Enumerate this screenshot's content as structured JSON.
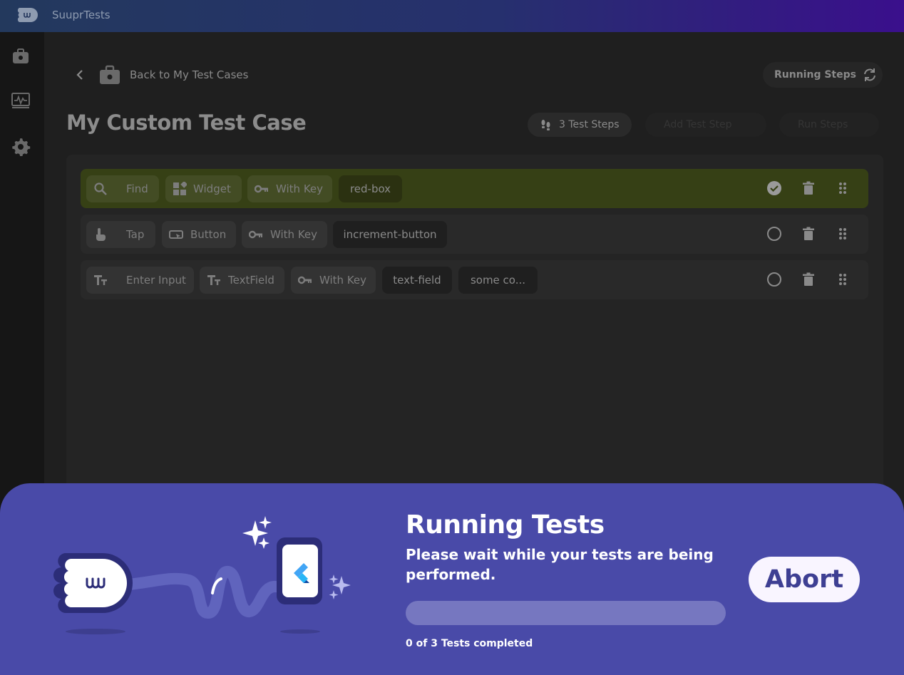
{
  "app": {
    "title": "SuuprTests"
  },
  "sidebar": {
    "items": [
      {
        "icon": "briefcase-icon"
      },
      {
        "icon": "monitor-pulse-icon"
      },
      {
        "icon": "gear-icon"
      }
    ]
  },
  "header": {
    "back_label": "Back to My Test Cases",
    "running_label": "Running Steps",
    "page_title": "My Custom Test Case",
    "steps_count_label": "3 Test Steps",
    "add_step_label": "Add Test Step",
    "run_label": "Run Steps"
  },
  "steps": [
    {
      "action": "Find",
      "target": "Widget",
      "matcher": "With Key",
      "values": [
        "red-box"
      ],
      "status": "done"
    },
    {
      "action": "Tap",
      "target": "Button",
      "matcher": "With Key",
      "values": [
        "increment-button"
      ],
      "status": "pending"
    },
    {
      "action": "Enter Input",
      "target": "TextField",
      "matcher": "With Key",
      "values": [
        "text-field",
        "some co..."
      ],
      "status": "pending"
    }
  ],
  "overlay": {
    "title": "Running Tests",
    "subtitle": "Please wait while your tests are being performed.",
    "progress_fraction": 0,
    "progress_text": "0 of 3 Tests completed",
    "abort_label": "Abort"
  },
  "colors": {
    "accent": "#494aa8",
    "active_row": "#364015",
    "abort_text": "#3e3f93"
  }
}
